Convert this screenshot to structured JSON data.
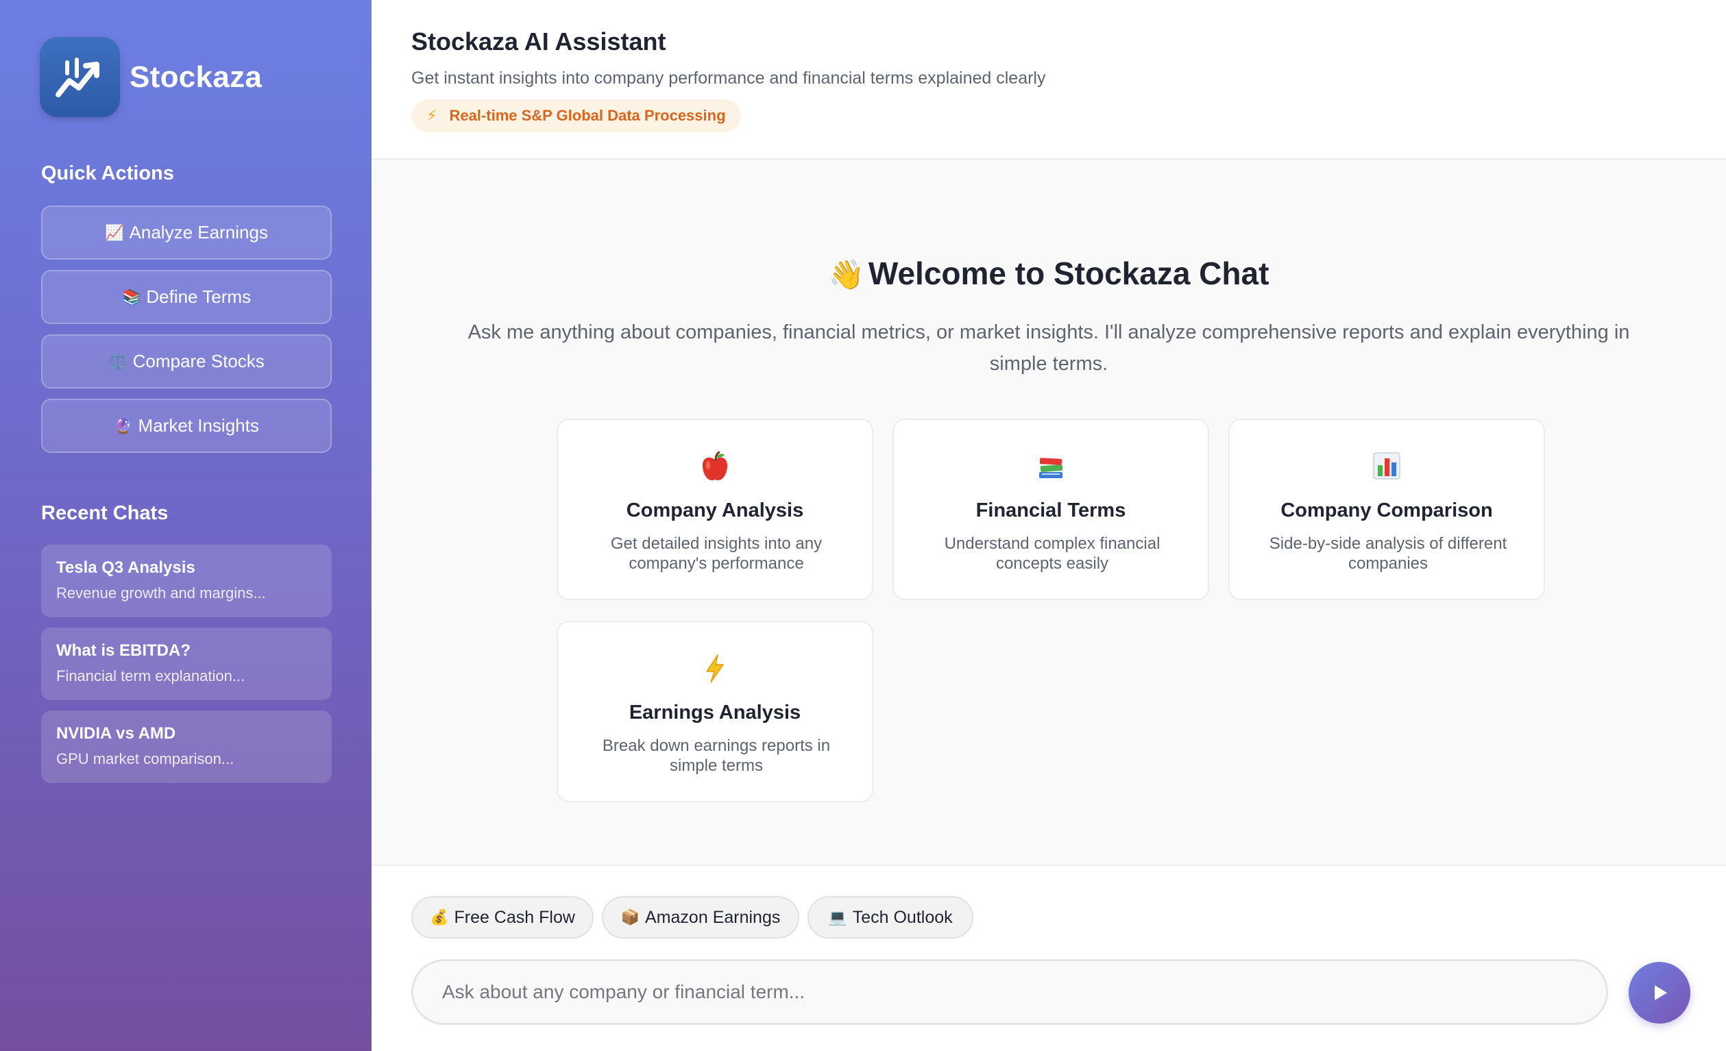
{
  "brand": {
    "name": "Stockaza",
    "logo_icon": "chart-up-icon"
  },
  "sidebar": {
    "quick_actions_title": "Quick Actions",
    "quick_actions": [
      {
        "emoji": "📈",
        "label": "Analyze Earnings"
      },
      {
        "emoji": "📚",
        "label": "Define Terms"
      },
      {
        "emoji": "⚖️",
        "label": "Compare Stocks"
      },
      {
        "emoji": "🔮",
        "label": "Market Insights"
      }
    ],
    "recent_chats_title": "Recent Chats",
    "recent_chats": [
      {
        "title": "Tesla Q3 Analysis",
        "subtitle": "Revenue growth and margins..."
      },
      {
        "title": "What is EBITDA?",
        "subtitle": "Financial term explanation..."
      },
      {
        "title": "NVIDIA vs AMD",
        "subtitle": "GPU market comparison..."
      }
    ]
  },
  "header": {
    "title": "Stockaza AI Assistant",
    "subtitle": "Get instant insights into company performance and financial terms explained clearly",
    "badge_icon": "⚡",
    "badge": "Real-time S&P Global Data Processing"
  },
  "welcome": {
    "emoji": "👋",
    "title": "Welcome to Stockaza Chat",
    "description": "Ask me anything about companies, financial metrics, or market insights. I'll analyze comprehensive reports and explain everything in simple terms."
  },
  "cards": [
    {
      "icon": "apple-icon",
      "title": "Company Analysis",
      "description": "Get detailed insights into any company's performance"
    },
    {
      "icon": "books-icon",
      "title": "Financial Terms",
      "description": "Understand complex financial concepts easily"
    },
    {
      "icon": "bar-chart-icon",
      "title": "Company Comparison",
      "description": "Side-by-side analysis of different companies"
    },
    {
      "icon": "lightning-icon",
      "title": "Earnings Analysis",
      "description": "Break down earnings reports in simple terms"
    }
  ],
  "suggestions": [
    {
      "emoji": "💰",
      "label": "Free Cash Flow"
    },
    {
      "emoji": "📦",
      "label": "Amazon Earnings"
    },
    {
      "emoji": "💻",
      "label": "Tech Outlook"
    }
  ],
  "input": {
    "placeholder": "Ask about any company or financial term..."
  },
  "colors": {
    "accent": "#6e7fe0",
    "sidebar_top": "#6b7fe3",
    "sidebar_bottom": "#744fa0",
    "badge_text": "#d9661f"
  }
}
